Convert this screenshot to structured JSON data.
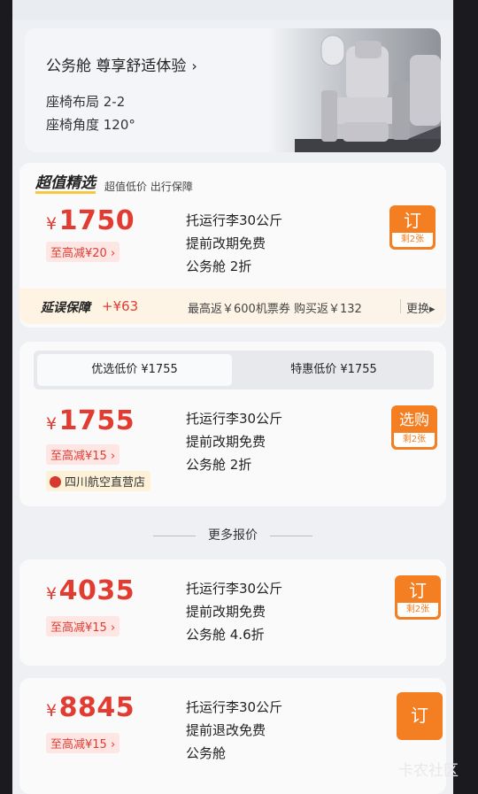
{
  "cabin": {
    "title": "公务舱 尊享舒适体验",
    "chevron": "›",
    "layout": "座椅布局 2-2",
    "angle": "座椅角度 120°"
  },
  "pick": {
    "title": "超值精选",
    "subtitle": "超值低价 出行保障",
    "yen": "¥",
    "price": "1750",
    "discount": "至高减¥20 ›",
    "features": [
      "托运行李30公斤",
      "提前改期免费",
      "公务舱 2折"
    ],
    "button": {
      "label": "订",
      "remaining": "剩2张"
    },
    "delay": {
      "title": "延误保障",
      "price": "+¥63",
      "desc": "最高返￥600机票券 购买返￥132",
      "change": "更换▸"
    }
  },
  "card2": {
    "tabs": [
      {
        "label": "优选低价 ¥1755",
        "active": true
      },
      {
        "label": "特惠低价 ¥1755",
        "active": false
      }
    ],
    "yen": "¥",
    "price": "1755",
    "discount": "至高减¥15 ›",
    "features": [
      "托运行李30公斤",
      "提前改期免费",
      "公务舱 2折"
    ],
    "store": "四川航空直营店",
    "button": {
      "label": "选购",
      "remaining": "剩2张"
    }
  },
  "more_label": "更多报价",
  "card3": {
    "yen": "¥",
    "price": "4035",
    "discount": "至高减¥15 ›",
    "features": [
      "托运行李30公斤",
      "提前改期免费",
      "公务舱 4.6折"
    ],
    "button": {
      "label": "订",
      "remaining": "剩2张"
    }
  },
  "card4": {
    "yen": "¥",
    "price": "8845",
    "discount": "至高减¥15 ›",
    "features": [
      "托运行李30公斤",
      "提前退改免费",
      "公务舱"
    ],
    "button": {
      "label": "订"
    }
  },
  "watermark": "卡农社区",
  "colors": {
    "price_red": "#e23c32",
    "button_orange": "#f47f22"
  }
}
